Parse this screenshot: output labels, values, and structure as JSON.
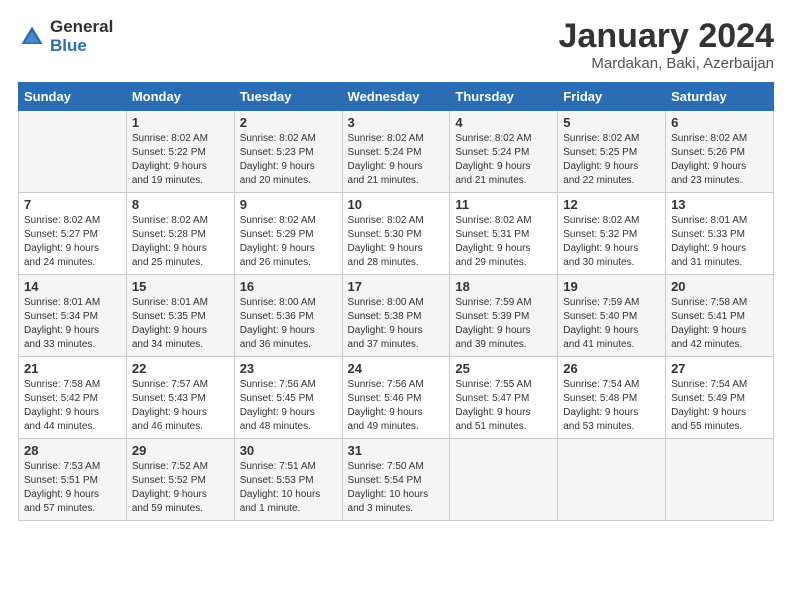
{
  "header": {
    "logo_general": "General",
    "logo_blue": "Blue",
    "title": "January 2024",
    "location": "Mardakan, Baki, Azerbaijan"
  },
  "days_of_week": [
    "Sunday",
    "Monday",
    "Tuesday",
    "Wednesday",
    "Thursday",
    "Friday",
    "Saturday"
  ],
  "weeks": [
    [
      {
        "day": "",
        "info": ""
      },
      {
        "day": "1",
        "info": "Sunrise: 8:02 AM\nSunset: 5:22 PM\nDaylight: 9 hours\nand 19 minutes."
      },
      {
        "day": "2",
        "info": "Sunrise: 8:02 AM\nSunset: 5:23 PM\nDaylight: 9 hours\nand 20 minutes."
      },
      {
        "day": "3",
        "info": "Sunrise: 8:02 AM\nSunset: 5:24 PM\nDaylight: 9 hours\nand 21 minutes."
      },
      {
        "day": "4",
        "info": "Sunrise: 8:02 AM\nSunset: 5:24 PM\nDaylight: 9 hours\nand 21 minutes."
      },
      {
        "day": "5",
        "info": "Sunrise: 8:02 AM\nSunset: 5:25 PM\nDaylight: 9 hours\nand 22 minutes."
      },
      {
        "day": "6",
        "info": "Sunrise: 8:02 AM\nSunset: 5:26 PM\nDaylight: 9 hours\nand 23 minutes."
      }
    ],
    [
      {
        "day": "7",
        "info": "Sunrise: 8:02 AM\nSunset: 5:27 PM\nDaylight: 9 hours\nand 24 minutes."
      },
      {
        "day": "8",
        "info": "Sunrise: 8:02 AM\nSunset: 5:28 PM\nDaylight: 9 hours\nand 25 minutes."
      },
      {
        "day": "9",
        "info": "Sunrise: 8:02 AM\nSunset: 5:29 PM\nDaylight: 9 hours\nand 26 minutes."
      },
      {
        "day": "10",
        "info": "Sunrise: 8:02 AM\nSunset: 5:30 PM\nDaylight: 9 hours\nand 28 minutes."
      },
      {
        "day": "11",
        "info": "Sunrise: 8:02 AM\nSunset: 5:31 PM\nDaylight: 9 hours\nand 29 minutes."
      },
      {
        "day": "12",
        "info": "Sunrise: 8:02 AM\nSunset: 5:32 PM\nDaylight: 9 hours\nand 30 minutes."
      },
      {
        "day": "13",
        "info": "Sunrise: 8:01 AM\nSunset: 5:33 PM\nDaylight: 9 hours\nand 31 minutes."
      }
    ],
    [
      {
        "day": "14",
        "info": "Sunrise: 8:01 AM\nSunset: 5:34 PM\nDaylight: 9 hours\nand 33 minutes."
      },
      {
        "day": "15",
        "info": "Sunrise: 8:01 AM\nSunset: 5:35 PM\nDaylight: 9 hours\nand 34 minutes."
      },
      {
        "day": "16",
        "info": "Sunrise: 8:00 AM\nSunset: 5:36 PM\nDaylight: 9 hours\nand 36 minutes."
      },
      {
        "day": "17",
        "info": "Sunrise: 8:00 AM\nSunset: 5:38 PM\nDaylight: 9 hours\nand 37 minutes."
      },
      {
        "day": "18",
        "info": "Sunrise: 7:59 AM\nSunset: 5:39 PM\nDaylight: 9 hours\nand 39 minutes."
      },
      {
        "day": "19",
        "info": "Sunrise: 7:59 AM\nSunset: 5:40 PM\nDaylight: 9 hours\nand 41 minutes."
      },
      {
        "day": "20",
        "info": "Sunrise: 7:58 AM\nSunset: 5:41 PM\nDaylight: 9 hours\nand 42 minutes."
      }
    ],
    [
      {
        "day": "21",
        "info": "Sunrise: 7:58 AM\nSunset: 5:42 PM\nDaylight: 9 hours\nand 44 minutes."
      },
      {
        "day": "22",
        "info": "Sunrise: 7:57 AM\nSunset: 5:43 PM\nDaylight: 9 hours\nand 46 minutes."
      },
      {
        "day": "23",
        "info": "Sunrise: 7:56 AM\nSunset: 5:45 PM\nDaylight: 9 hours\nand 48 minutes."
      },
      {
        "day": "24",
        "info": "Sunrise: 7:56 AM\nSunset: 5:46 PM\nDaylight: 9 hours\nand 49 minutes."
      },
      {
        "day": "25",
        "info": "Sunrise: 7:55 AM\nSunset: 5:47 PM\nDaylight: 9 hours\nand 51 minutes."
      },
      {
        "day": "26",
        "info": "Sunrise: 7:54 AM\nSunset: 5:48 PM\nDaylight: 9 hours\nand 53 minutes."
      },
      {
        "day": "27",
        "info": "Sunrise: 7:54 AM\nSunset: 5:49 PM\nDaylight: 9 hours\nand 55 minutes."
      }
    ],
    [
      {
        "day": "28",
        "info": "Sunrise: 7:53 AM\nSunset: 5:51 PM\nDaylight: 9 hours\nand 57 minutes."
      },
      {
        "day": "29",
        "info": "Sunrise: 7:52 AM\nSunset: 5:52 PM\nDaylight: 9 hours\nand 59 minutes."
      },
      {
        "day": "30",
        "info": "Sunrise: 7:51 AM\nSunset: 5:53 PM\nDaylight: 10 hours\nand 1 minute."
      },
      {
        "day": "31",
        "info": "Sunrise: 7:50 AM\nSunset: 5:54 PM\nDaylight: 10 hours\nand 3 minutes."
      },
      {
        "day": "",
        "info": ""
      },
      {
        "day": "",
        "info": ""
      },
      {
        "day": "",
        "info": ""
      }
    ]
  ]
}
